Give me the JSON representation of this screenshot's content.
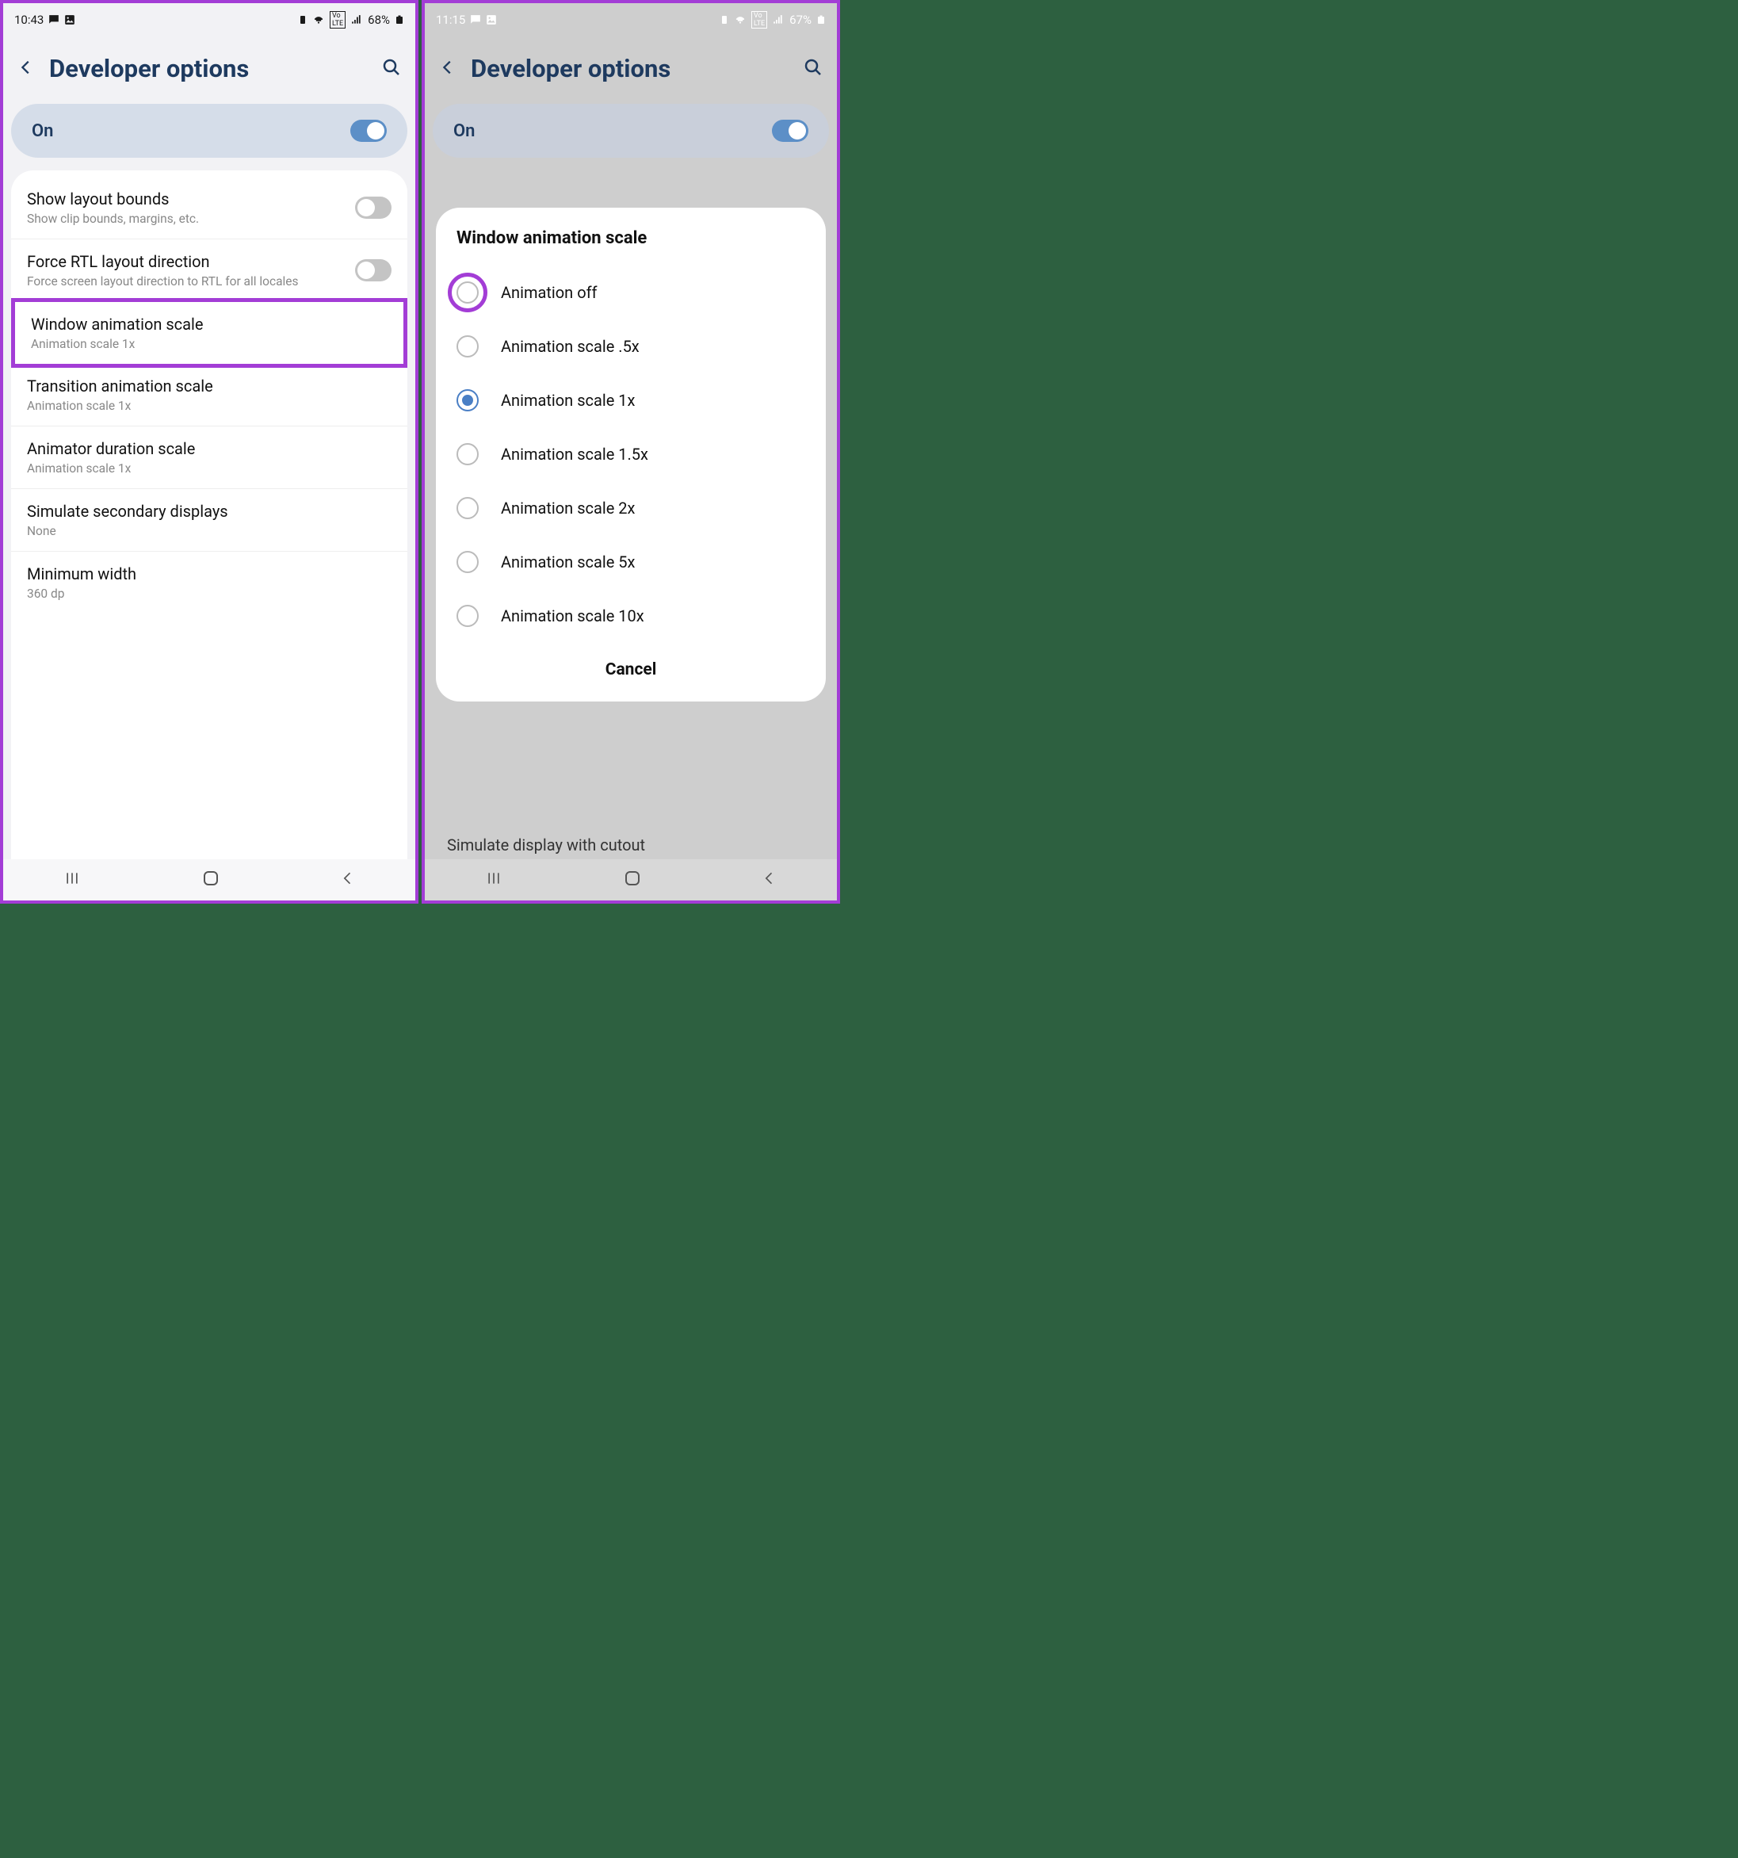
{
  "left": {
    "status": {
      "time": "10:43",
      "battery": "68%"
    },
    "header": {
      "title": "Developer options"
    },
    "on_pill": {
      "label": "On"
    },
    "items": [
      {
        "title": "Show layout bounds",
        "sub": "Show clip bounds, margins, etc.",
        "toggle": true
      },
      {
        "title": "Force RTL layout direction",
        "sub": "Force screen layout direction to RTL for all locales",
        "toggle": true
      },
      {
        "title": "Window animation scale",
        "sub": "Animation scale 1x",
        "highlight": true
      },
      {
        "title": "Transition animation scale",
        "sub": "Animation scale 1x"
      },
      {
        "title": "Animator duration scale",
        "sub": "Animation scale 1x"
      },
      {
        "title": "Simulate secondary displays",
        "sub": "None"
      },
      {
        "title": "Minimum width",
        "sub": "360 dp"
      }
    ]
  },
  "right": {
    "status": {
      "time": "11:15",
      "battery": "67%"
    },
    "header": {
      "title": "Developer options"
    },
    "on_pill": {
      "label": "On"
    },
    "dialog": {
      "title": "Window animation scale",
      "options": [
        {
          "label": "Animation off",
          "highlight": true
        },
        {
          "label": "Animation scale .5x"
        },
        {
          "label": "Animation scale 1x",
          "selected": true
        },
        {
          "label": "Animation scale 1.5x"
        },
        {
          "label": "Animation scale 2x"
        },
        {
          "label": "Animation scale 5x"
        },
        {
          "label": "Animation scale 10x"
        }
      ],
      "cancel": "Cancel"
    },
    "peek": "Simulate display with cutout"
  }
}
